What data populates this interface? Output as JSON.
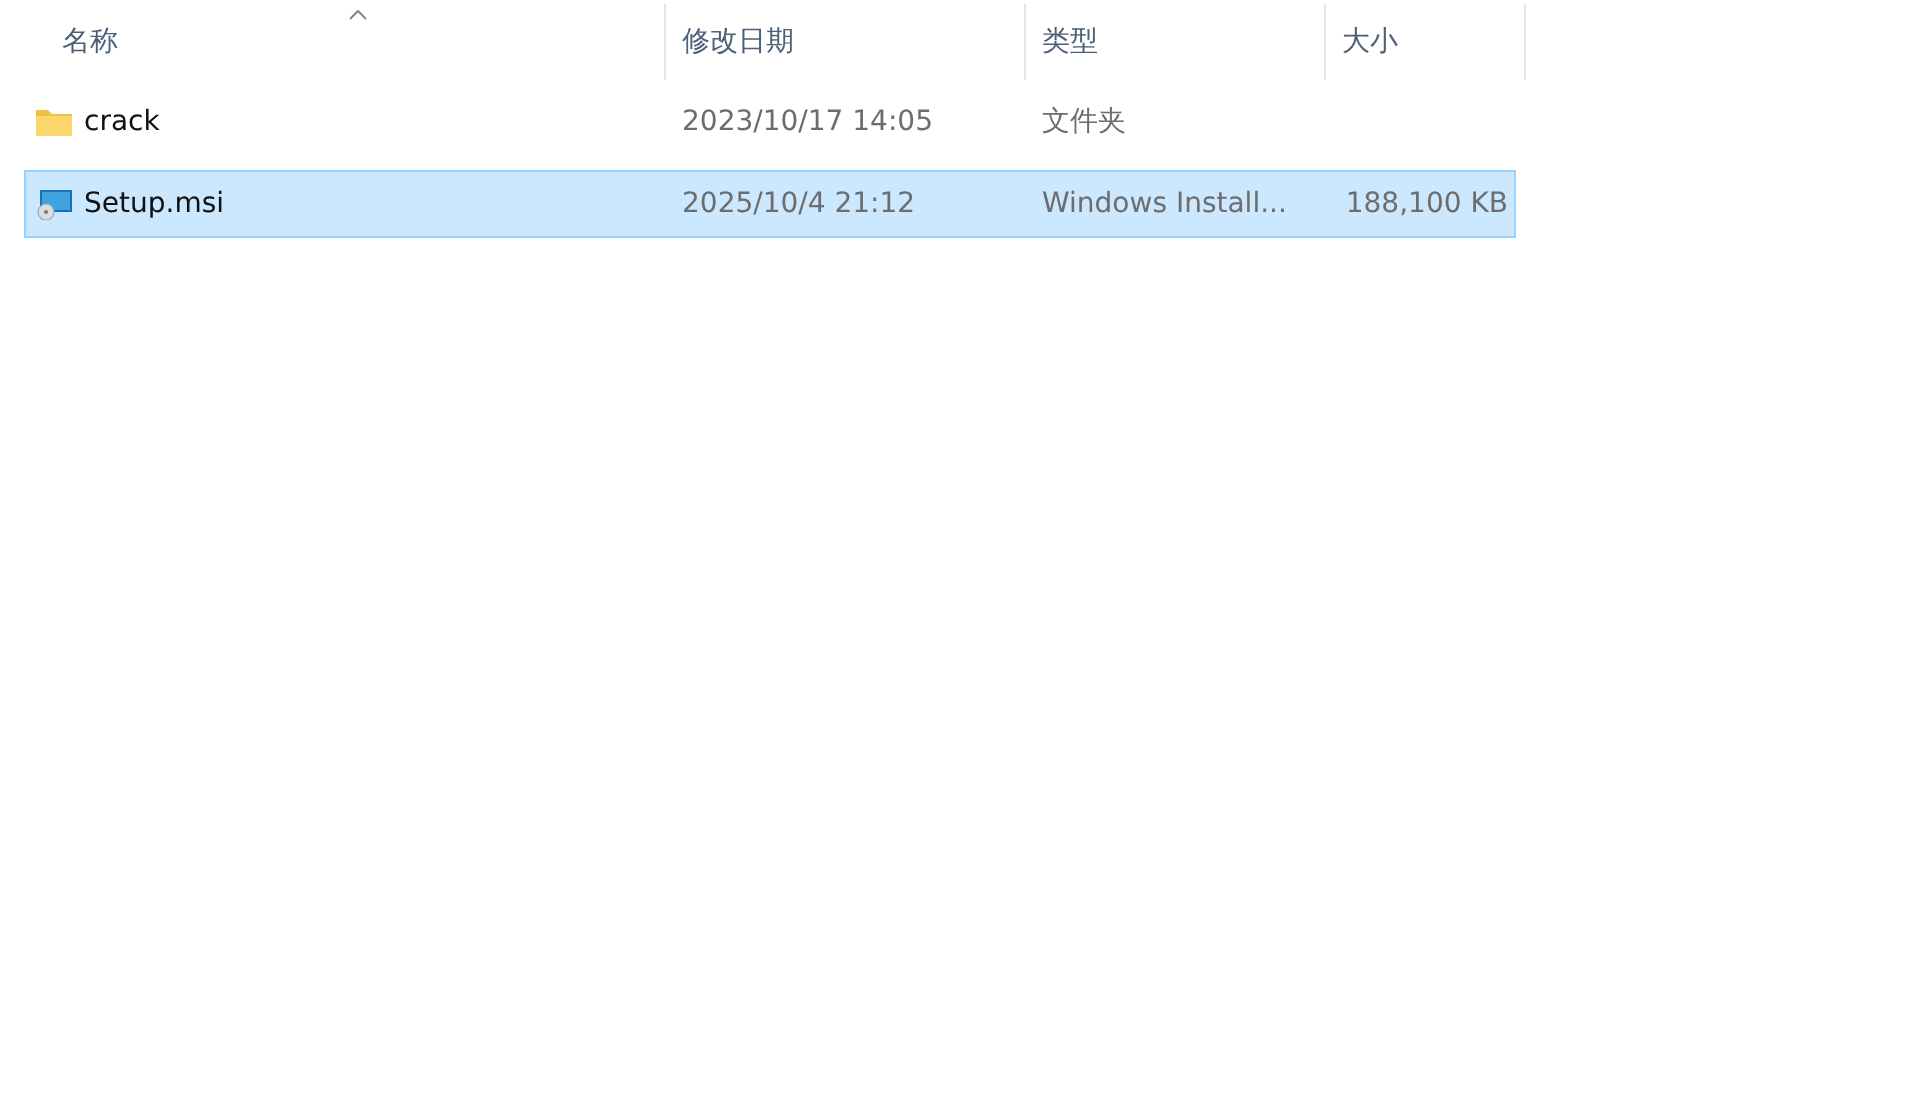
{
  "table": {
    "columns": [
      {
        "label": "名称",
        "sorted": true
      },
      {
        "label": "修改日期",
        "sorted": false
      },
      {
        "label": "类型",
        "sorted": false
      },
      {
        "label": "大小",
        "sorted": false
      }
    ],
    "rows": [
      {
        "kind": "folder",
        "name": "crack",
        "modified": "2023/10/17 14:05",
        "type": "文件夹",
        "selected": false
      },
      {
        "kind": "installer",
        "name": "Setup.msi",
        "modified": "2025/10/4 21:12",
        "type": "Windows Install...",
        "size": "188,100 KB",
        "selected": true
      }
    ]
  }
}
